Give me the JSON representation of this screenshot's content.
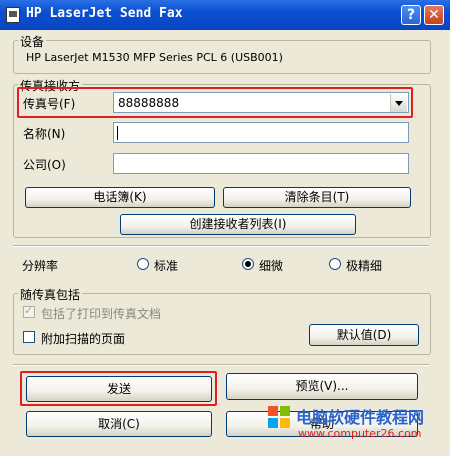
{
  "window": {
    "title": "HP LaserJet Send Fax",
    "help_glyph": "?",
    "close_glyph": "✕"
  },
  "device": {
    "legend": "设备",
    "name": "HP LaserJet M1530 MFP Series PCL 6 (USB001)"
  },
  "recipient": {
    "legend": "传真接收方",
    "fax_label": "传真号(F)",
    "fax_value": "88888888",
    "name_label": "名称(N)",
    "name_value": "",
    "company_label": "公司(O)",
    "company_value": "",
    "phonebook_button": "电话簿(K)",
    "clear_button": "清除条目(T)",
    "create_list_button": "创建接收者列表(I)"
  },
  "resolution": {
    "label": "分辨率",
    "options": [
      "标准",
      "细微",
      "极精细"
    ],
    "selected": "细微"
  },
  "include": {
    "legend": "随传真包括",
    "printed_doc_label": "包括了打印到传真文档",
    "printed_doc_checked": true,
    "scanned_pages_label": "附加扫描的页面",
    "scanned_pages_checked": false,
    "defaults_button": "默认值(D)"
  },
  "actions": {
    "send_button": "发送",
    "preview_button": "预览(V)...",
    "cancel_button": "取消(C)",
    "help_button": "帮助"
  },
  "watermark": {
    "title": "电脑软硬件教程网",
    "url": "www.computer26.com"
  },
  "colors": {
    "highlight": "#e02020",
    "titlebar": "#0a4fd0",
    "dialog_bg": "#ece9d8"
  }
}
